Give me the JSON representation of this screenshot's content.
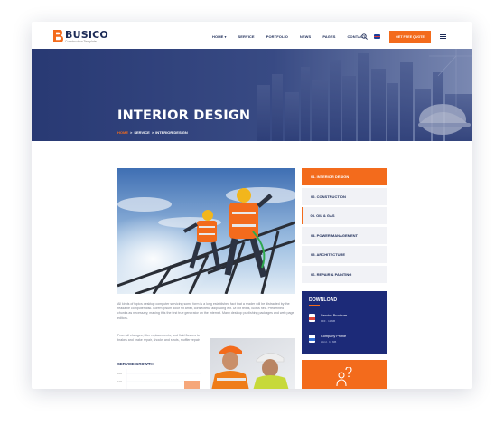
{
  "brand": {
    "name": "BUSICO",
    "tagline": "Construction Template",
    "logo_letter": "B",
    "accent_color": "#f36b1c",
    "navy_color": "#1c2b57"
  },
  "nav": {
    "items": [
      {
        "label": "HOME",
        "has_dropdown": true
      },
      {
        "label": "SERVICE"
      },
      {
        "label": "PORTFOLIO"
      },
      {
        "label": "NEWS"
      },
      {
        "label": "PAGES"
      },
      {
        "label": "CONTACT"
      }
    ],
    "caret": "▾",
    "cta_label": "GET FREE QUOTE",
    "search_icon": "search-icon",
    "flag_icon": "uk-flag-icon",
    "menu_icon": "hamburger-icon"
  },
  "hero": {
    "title": "INTERIOR DESIGN",
    "breadcrumb": {
      "home": "HOME",
      "separator": ">",
      "section": "SERVICE",
      "current": "INTERIOR DESIGN"
    }
  },
  "content": {
    "paragraph1": "All kinds of topics desktop computer servicing some form is a long established fact that a reader will be distracted by the readable computer disk. Lorem ipsum dolor sit amet, consectetur adipiscing elit. Ut elit tellus, luctus nec. Predefined chunks as necessary, making this the first true generator on the Internet. Many desktop publishing packages and web page editors.",
    "paragraph2": "From all changes, filter replacements, and fluid flushes to brakes and brake repair, shocks and struts, muffler repair",
    "growth_title": "SERVICE GROWTH",
    "chart_ticks": [
      "100",
      "100"
    ]
  },
  "sidebar": {
    "items": [
      {
        "label": "01.   INTERIOR DESIGN",
        "active": true
      },
      {
        "label": "02.   CONSTRUCTION",
        "active": false
      },
      {
        "label": "03.   OIL & GAS",
        "active": false
      },
      {
        "label": "04.   POWER MANAGEMENT",
        "active": false
      },
      {
        "label": "05.   ARCHITECTURE",
        "active": false
      },
      {
        "label": "06.   REPAIR & PAINTING",
        "active": false
      }
    ]
  },
  "download": {
    "title": "DOWNLOAD",
    "files": [
      {
        "name": "Service Brochure",
        "meta": "PDF  ·  12 MB",
        "color": "#e0443a"
      },
      {
        "name": "Company Profile",
        "meta": "Word  ·  13 MB",
        "color": "#2f6fd6"
      }
    ]
  }
}
